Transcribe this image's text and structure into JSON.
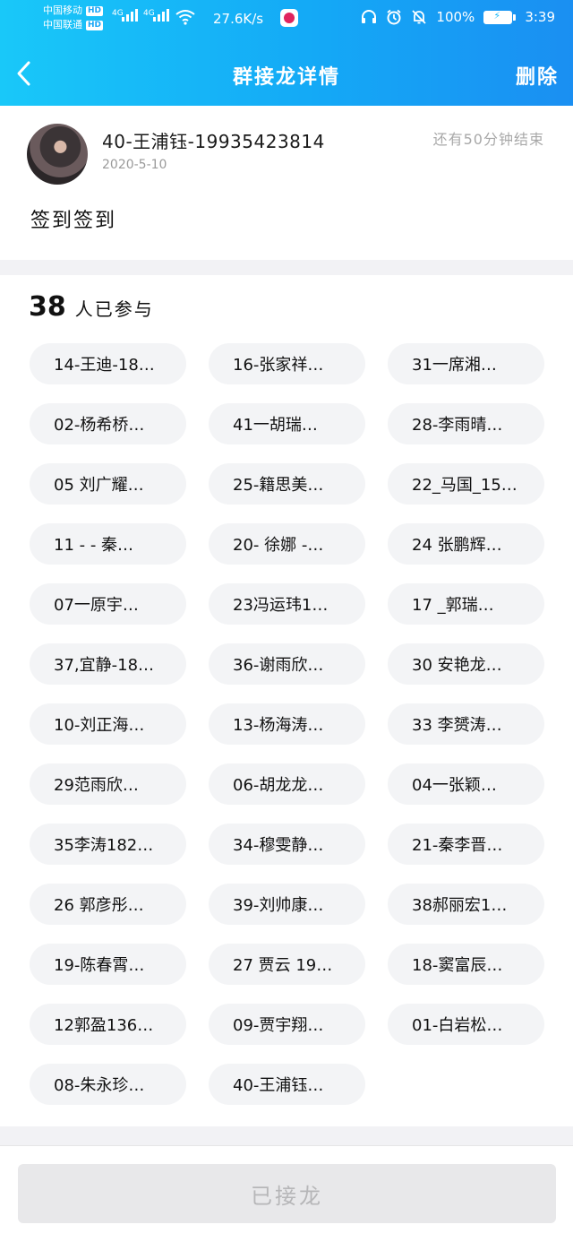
{
  "status_bar": {
    "carrier_1": "中国移动",
    "carrier_2": "中国联通",
    "hd_label": "HD",
    "net_type": "4G",
    "speed": "27.6K/s",
    "battery": "100%",
    "time": "3:39"
  },
  "nav": {
    "title": "群接龙详情",
    "delete_label": "删除"
  },
  "post": {
    "author": "40-王浦钰-19935423814",
    "date": "2020-5-10",
    "remaining": "还有50分钟结束",
    "content": "签到签到"
  },
  "participants": {
    "count": "38",
    "count_label": "人已参与",
    "items": [
      "14-王迪-18…",
      "16-张家祥…",
      "31一席湘…",
      "02-杨希桥…",
      "41一胡瑞…",
      "28-李雨晴…",
      "05 刘广耀…",
      "25-籍思美…",
      "22_马国_15…",
      "11 - - 秦…",
      "20- 徐娜 -…",
      "24 张鹏辉…",
      "07一原宇…",
      "23冯运玮1…",
      "17 _郭瑞…",
      "37,宜静-18…",
      "36-谢雨欣…",
      "30 安艳龙…",
      "10-刘正海…",
      "13-杨海涛…",
      "33 李赟涛…",
      "29范雨欣…",
      "06-胡龙龙…",
      "04一张颖…",
      "35李涛182…",
      "34-穆雯静…",
      "21-秦李晋…",
      "26 郭彦彤…",
      "39-刘帅康…",
      "38郝丽宏1…",
      "19-陈春霄…",
      "27 贾云 19…",
      "18-窦富辰…",
      "12郭盈136…",
      "09-贾宇翔…",
      "01-白岩松…",
      "08-朱永珍…",
      "40-王浦钰…"
    ]
  },
  "bottom": {
    "joined_label": "已接龙"
  },
  "colors": {
    "header_start": "#19c8f9",
    "header_end": "#1a8ff2",
    "chip_bg": "#f3f4f6",
    "button_disabled_bg": "#e8e8ea"
  }
}
